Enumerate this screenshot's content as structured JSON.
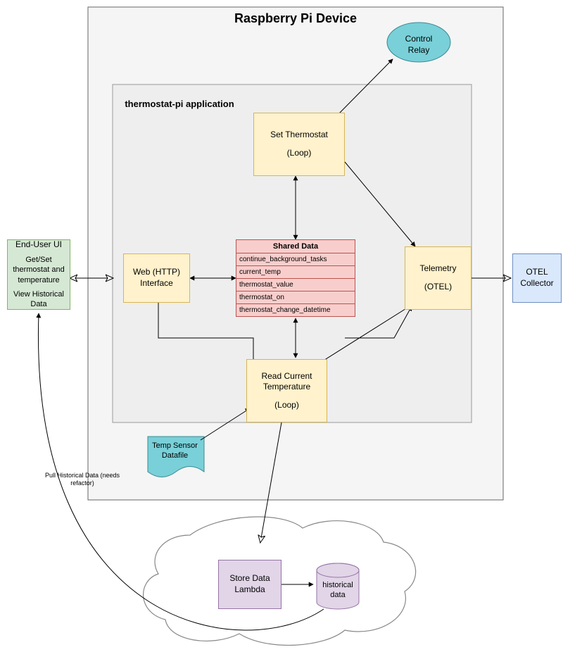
{
  "title": "Raspberry Pi Device",
  "inner_title": "thermostat-pi application",
  "nodes": {
    "end_user_line1": "End-User UI",
    "end_user_line2": "Get/Set thermostat and temperature",
    "end_user_line3": "View Historical Data",
    "web_interface": "Web (HTTP) Interface",
    "set_thermostat_line1": "Set Thermostat",
    "set_thermostat_line2": "(Loop)",
    "telemetry_line1": "Telemetry",
    "telemetry_line2": "(OTEL)",
    "read_temp_line1": "Read Current Temperature",
    "read_temp_line2": "(Loop)",
    "control_relay": "Control Relay",
    "otel_collector": "OTEL Collector",
    "temp_sensor_file": "Temp Sensor Datafile",
    "store_data": "Store Data Lambda",
    "historical_db": "historical data"
  },
  "shared_data": {
    "header": "Shared Data",
    "fields": [
      "continue_background_tasks",
      "current_temp",
      "thermostat_value",
      "thermostat_on",
      "thermostat_change_datetime"
    ]
  },
  "edge_labels": {
    "pull_historical": "Pull Historical Data (needs refactor)"
  },
  "colors": {
    "yellow_fill": "#fff2cc",
    "green_fill": "#d5e8d4",
    "blue_fill": "#dae8fc",
    "purple_fill": "#e1d5e7",
    "red_fill": "#f8cecc",
    "teal_fill": "#79d0d8"
  }
}
